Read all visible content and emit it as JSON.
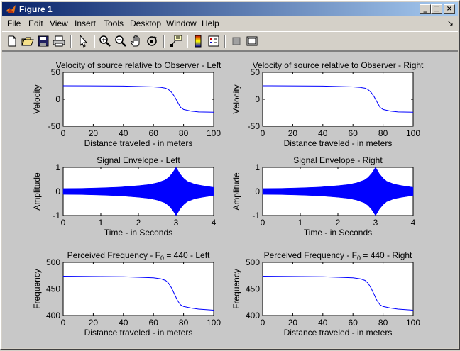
{
  "window": {
    "title": "Figure 1",
    "minimize_label": "_",
    "maximize_label": "□",
    "close_label": "×"
  },
  "menubar": {
    "items": [
      {
        "label": "File"
      },
      {
        "label": "Edit"
      },
      {
        "label": "View"
      },
      {
        "label": "Insert"
      },
      {
        "label": "Tools"
      },
      {
        "label": "Desktop"
      },
      {
        "label": "Window"
      },
      {
        "label": "Help"
      }
    ],
    "dock_label": "↘"
  },
  "toolbar": {
    "buttons": [
      {
        "icon": "new-figure-icon"
      },
      {
        "icon": "open-file-icon"
      },
      {
        "icon": "save-icon"
      },
      {
        "icon": "print-icon"
      },
      {
        "icon": "edit-plot-arrow-icon"
      },
      {
        "icon": "zoom-in-icon"
      },
      {
        "icon": "zoom-out-icon"
      },
      {
        "icon": "pan-hand-icon"
      },
      {
        "icon": "rotate-3d-icon"
      },
      {
        "icon": "data-cursor-icon"
      },
      {
        "icon": "colorbar-icon"
      },
      {
        "icon": "legend-icon"
      },
      {
        "icon": "hide-plot-tools-icon"
      },
      {
        "icon": "show-plot-tools-icon"
      }
    ]
  },
  "colors": {
    "line": "#0000ff",
    "figure_bg": "#c8c8c8",
    "axes_bg": "#ffffff"
  },
  "chart_data": [
    {
      "type": "line",
      "title": "Velocity of source relative to Observer - Left",
      "xlabel": "Distance traveled - in meters",
      "ylabel": "Velocity",
      "xlim": [
        0,
        100
      ],
      "ylim": [
        -50,
        50
      ],
      "xticks": [
        "0",
        "20",
        "40",
        "60",
        "80",
        "100"
      ],
      "yticks": [
        "-50",
        "0",
        "50"
      ],
      "x": [
        0,
        40,
        60,
        65,
        68,
        70,
        72,
        74,
        76,
        78,
        80,
        85,
        90,
        100
      ],
      "y": [
        25,
        24.5,
        23,
        22,
        20.5,
        18,
        13,
        5,
        -5,
        -15,
        -19,
        -22,
        -23.5,
        -24
      ]
    },
    {
      "type": "line",
      "title": "Velocity of source relative to Observer - Right",
      "xlabel": "Distance traveled - in meters",
      "ylabel": "Velocity",
      "xlim": [
        0,
        100
      ],
      "ylim": [
        -50,
        50
      ],
      "xticks": [
        "0",
        "20",
        "40",
        "60",
        "80",
        "100"
      ],
      "yticks": [
        "-50",
        "0",
        "50"
      ],
      "x": [
        0,
        40,
        60,
        65,
        68,
        70,
        72,
        74,
        76,
        78,
        80,
        85,
        90,
        100
      ],
      "y": [
        25,
        24.5,
        23,
        22,
        20.5,
        18,
        13,
        5,
        -5,
        -15,
        -19,
        -22,
        -23.5,
        -24
      ]
    },
    {
      "type": "area",
      "title": "Signal Envelope - Left",
      "xlabel": "Time - in Seconds",
      "ylabel": "Amplitude",
      "xlim": [
        0,
        4
      ],
      "ylim": [
        -1,
        1
      ],
      "xticks": [
        "0",
        "1",
        "2",
        "3",
        "4"
      ],
      "yticks": [
        "-1",
        "0",
        "1"
      ],
      "x": [
        0,
        0.5,
        1,
        1.5,
        2,
        2.3,
        2.5,
        2.7,
        2.8,
        2.9,
        2.95,
        3,
        3.05,
        3.1,
        3.2,
        3.3,
        3.5,
        3.7,
        4
      ],
      "envelope": [
        0.12,
        0.13,
        0.15,
        0.18,
        0.24,
        0.29,
        0.36,
        0.47,
        0.58,
        0.76,
        0.88,
        1.0,
        0.88,
        0.74,
        0.55,
        0.42,
        0.3,
        0.24,
        0.17
      ]
    },
    {
      "type": "area",
      "title": "Signal Envelope - Right",
      "xlabel": "Time - in Seconds",
      "ylabel": "Amplitude",
      "xlim": [
        0,
        4
      ],
      "ylim": [
        -1,
        1
      ],
      "xticks": [
        "0",
        "1",
        "2",
        "3",
        "4"
      ],
      "yticks": [
        "-1",
        "0",
        "1"
      ],
      "x": [
        0,
        0.5,
        1,
        1.5,
        2,
        2.3,
        2.5,
        2.7,
        2.8,
        2.9,
        2.95,
        3,
        3.05,
        3.1,
        3.2,
        3.3,
        3.5,
        3.7,
        4
      ],
      "envelope": [
        0.12,
        0.13,
        0.15,
        0.18,
        0.24,
        0.29,
        0.36,
        0.47,
        0.58,
        0.76,
        0.88,
        1.0,
        0.88,
        0.74,
        0.55,
        0.42,
        0.3,
        0.24,
        0.17
      ]
    },
    {
      "type": "line",
      "title": "Perceived Frequency - F",
      "title_subscript": "0",
      "title_suffix": " = 440 - Left",
      "xlabel": "Distance traveled - in meters",
      "ylabel": "Frequency",
      "xlim": [
        0,
        100
      ],
      "ylim": [
        400,
        500
      ],
      "xticks": [
        "0",
        "20",
        "40",
        "60",
        "80",
        "100"
      ],
      "yticks": [
        "400",
        "450",
        "500"
      ],
      "x": [
        0,
        40,
        60,
        65,
        68,
        70,
        72,
        74,
        76,
        78,
        80,
        85,
        90,
        100
      ],
      "y": [
        474,
        473,
        471,
        469,
        466,
        461,
        452,
        440,
        428,
        420,
        417,
        414,
        412,
        410
      ]
    },
    {
      "type": "line",
      "title": "Perceived Frequency - F",
      "title_subscript": "0",
      "title_suffix": " = 440 - Right",
      "xlabel": "Distance traveled - in meters",
      "ylabel": "Frequency",
      "xlim": [
        0,
        100
      ],
      "ylim": [
        400,
        500
      ],
      "xticks": [
        "0",
        "20",
        "40",
        "60",
        "80",
        "100"
      ],
      "yticks": [
        "400",
        "450",
        "500"
      ],
      "x": [
        0,
        40,
        60,
        65,
        68,
        70,
        72,
        74,
        76,
        78,
        80,
        85,
        90,
        100
      ],
      "y": [
        474,
        473,
        471,
        469,
        466,
        461,
        452,
        440,
        428,
        420,
        417,
        414,
        412,
        410
      ]
    }
  ]
}
